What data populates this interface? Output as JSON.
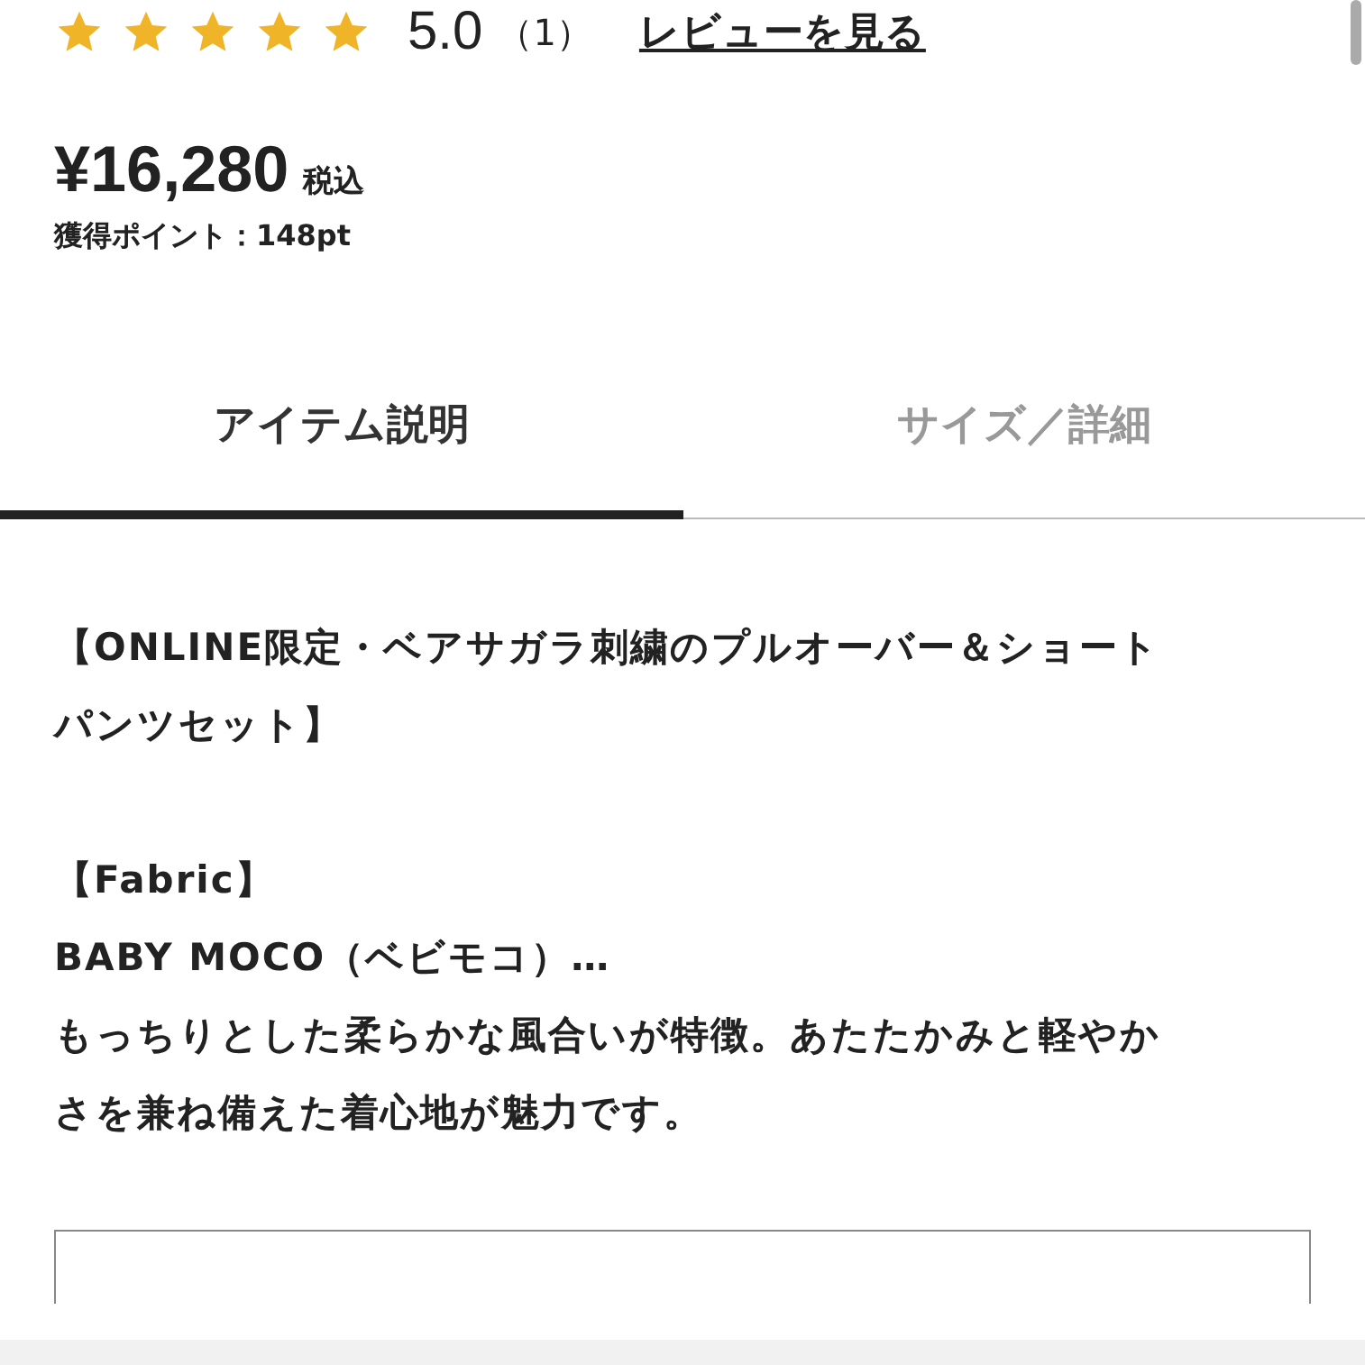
{
  "rating": {
    "stars": 5,
    "score": "5.0",
    "count": "（1）",
    "review_link": "レビューを見る"
  },
  "price": {
    "amount": "¥16,280",
    "tax_note": "税込",
    "points": "獲得ポイント：148pt"
  },
  "tabs": [
    {
      "label": "アイテム説明",
      "selected": true
    },
    {
      "label": "サイズ／詳細",
      "selected": false
    }
  ],
  "description": {
    "sections": [
      {
        "lines": [
          "【ONLINE限定・ベアサガラ刺繍のプルオーバー＆ショート",
          "パンツセット】"
        ]
      },
      {
        "lines": [
          "【Fabric】",
          "BABY MOCO（ベビモコ）…",
          "もっちりとした柔らかな風合いが特徴。あたたかみと軽やか",
          "さを兼ね備えた着心地が魅力です。"
        ]
      }
    ]
  }
}
